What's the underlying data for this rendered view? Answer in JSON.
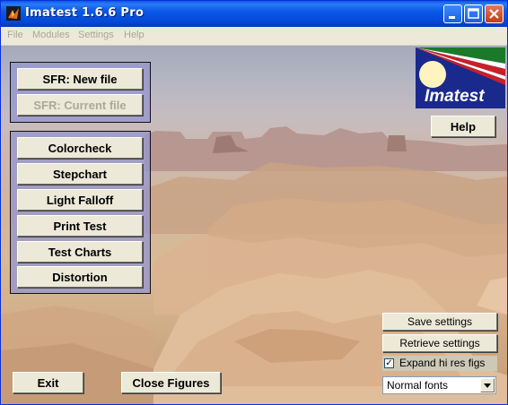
{
  "window": {
    "title": "Imatest 1.6.6  Pro"
  },
  "menu": {
    "items": [
      "File",
      "Modules",
      "Settings",
      "Help"
    ]
  },
  "sfr_panel": {
    "new_file": "SFR: New file",
    "current_file": "SFR: Current file"
  },
  "modules_panel": {
    "buttons": [
      "Colorcheck",
      "Stepchart",
      "Light Falloff",
      "Print Test",
      "Test Charts",
      "Distortion"
    ]
  },
  "logo": {
    "text": "Imatest"
  },
  "help_button": "Help",
  "settings": {
    "save": "Save settings",
    "retrieve": "Retrieve settings",
    "hires_label": "Expand hi res figs",
    "hires_checked": true,
    "fonts_value": "Normal fonts"
  },
  "bottom": {
    "exit": "Exit",
    "close_figures": "Close Figures"
  },
  "colors": {
    "titlebar": "#0a58e8",
    "panel": "#9696cd",
    "logo_bg": "#1a2a8c"
  }
}
